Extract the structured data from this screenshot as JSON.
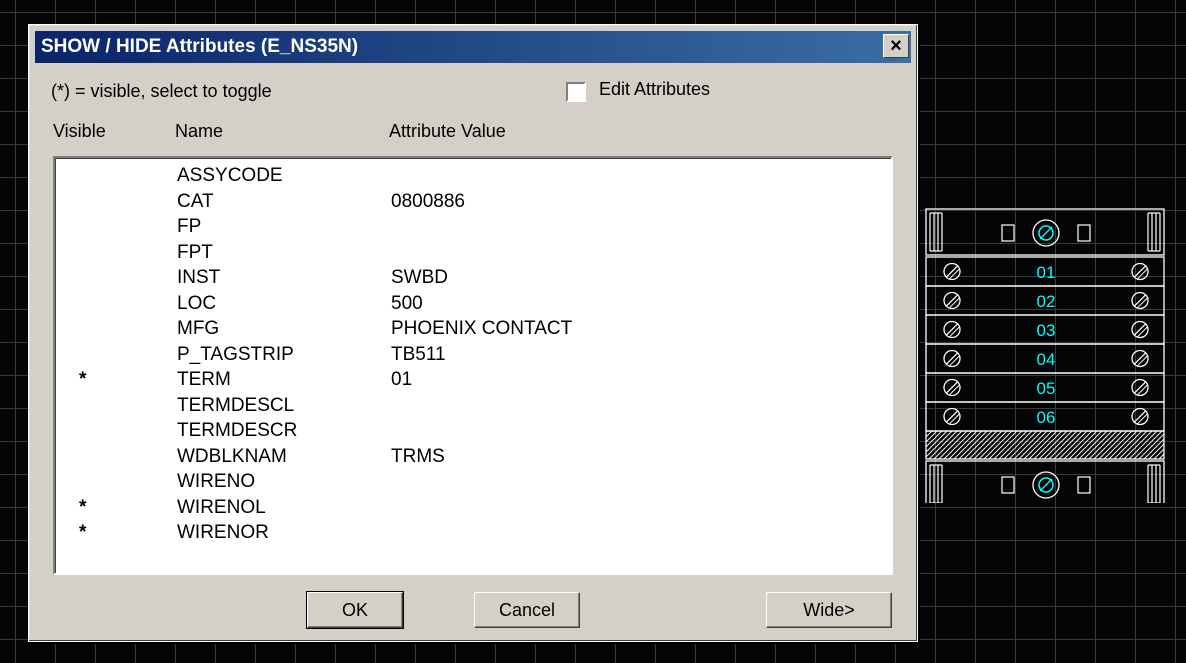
{
  "dialog": {
    "title": "SHOW / HIDE Attributes (E_NS35N)",
    "close_glyph": "×",
    "hint": "(*) = visible, select to toggle",
    "edit_attributes_label": "Edit Attributes",
    "edit_attributes_checked": false,
    "columns": {
      "visible": "Visible",
      "name": "Name",
      "value": "Attribute Value"
    },
    "rows": [
      {
        "visible": "",
        "name": "ASSYCODE",
        "value": ""
      },
      {
        "visible": "",
        "name": "CAT",
        "value": "0800886"
      },
      {
        "visible": "",
        "name": "FP",
        "value": ""
      },
      {
        "visible": "",
        "name": "FPT",
        "value": ""
      },
      {
        "visible": "",
        "name": "INST",
        "value": "SWBD"
      },
      {
        "visible": "",
        "name": "LOC",
        "value": "500"
      },
      {
        "visible": "",
        "name": "MFG",
        "value": "PHOENIX CONTACT"
      },
      {
        "visible": "",
        "name": "P_TAGSTRIP",
        "value": "TB511"
      },
      {
        "visible": "*",
        "name": "TERM",
        "value": "01"
      },
      {
        "visible": "",
        "name": "TERMDESCL",
        "value": ""
      },
      {
        "visible": "",
        "name": "TERMDESCR",
        "value": ""
      },
      {
        "visible": "",
        "name": "WDBLKNAM",
        "value": "TRMS"
      },
      {
        "visible": "",
        "name": "WIRENO",
        "value": ""
      },
      {
        "visible": "*",
        "name": "WIRENOL",
        "value": ""
      },
      {
        "visible": "*",
        "name": "WIRENOR",
        "value": ""
      }
    ],
    "buttons": {
      "ok": "OK",
      "cancel": "Cancel",
      "wide": "Wide>"
    }
  },
  "terminal_block": {
    "labels": [
      "01",
      "02",
      "03",
      "04",
      "05",
      "06"
    ],
    "line_color": "#ffffff",
    "label_color": "#00ffff"
  }
}
